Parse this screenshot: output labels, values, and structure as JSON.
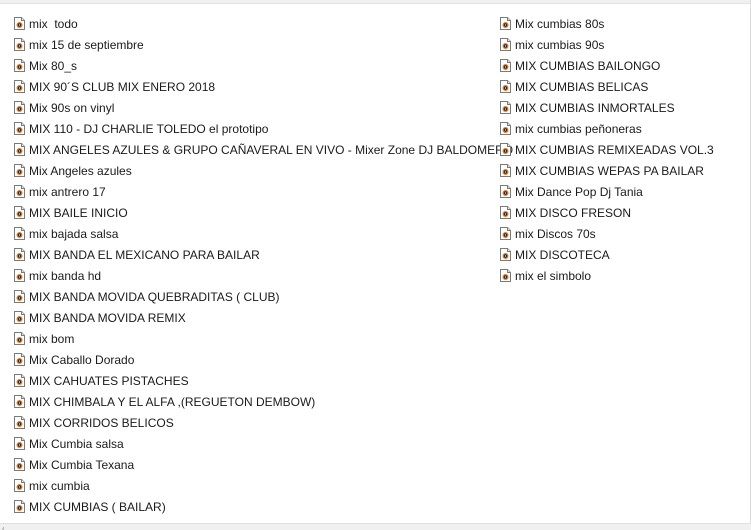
{
  "file_icon": "audio-file-icon",
  "columns": [
    {
      "items": [
        "mix  todo",
        "mix 15 de septiembre",
        "Mix 80_s",
        "MIX 90´S CLUB MIX ENERO 2018",
        "Mix 90s on vinyl",
        "MIX 110 - DJ CHARLIE TOLEDO el prototipo",
        "MIX ANGELES AZULES & GRUPO CAÑAVERAL EN VIVO - Mixer Zone DJ BALDOMERO",
        "Mix Angeles azules",
        "mix antrero 17",
        "MIX BAILE INICIO",
        "mix bajada salsa",
        "MIX BANDA EL MEXICANO PARA BAILAR",
        "mix banda hd",
        "MIX BANDA MOVIDA QUEBRADITAS ( CLUB)",
        "MIX BANDA MOVIDA REMIX",
        "mix bom",
        "Mix Caballo Dorado",
        "MIX CAHUATES PISTACHES",
        "MIX CHIMBALA Y EL ALFA ,(REGUETON DEMBOW)",
        "MIX CORRIDOS BELICOS",
        "Mix Cumbia salsa",
        "Mix Cumbia Texana",
        "mix cumbia",
        "MIX CUMBIAS ( BAILAR)"
      ]
    },
    {
      "items": [
        "Mix cumbias 80s",
        "mix cumbias 90s",
        "MIX CUMBIAS BAILONGO",
        "MIX CUMBIAS BELICAS",
        "MIX CUMBIAS INMORTALES",
        "mix cumbias peñoneras",
        "MIX CUMBIAS REMIXEADAS VOL.3",
        "MIX CUMBIAS WEPAS PA BAILAR",
        "Mix Dance Pop Dj Tania",
        "MIX DISCO FRESON",
        "mix Discos 70s",
        "MIX DISCOTECA",
        "mix el simbolo"
      ]
    }
  ],
  "scroll_left_glyph": "‹"
}
